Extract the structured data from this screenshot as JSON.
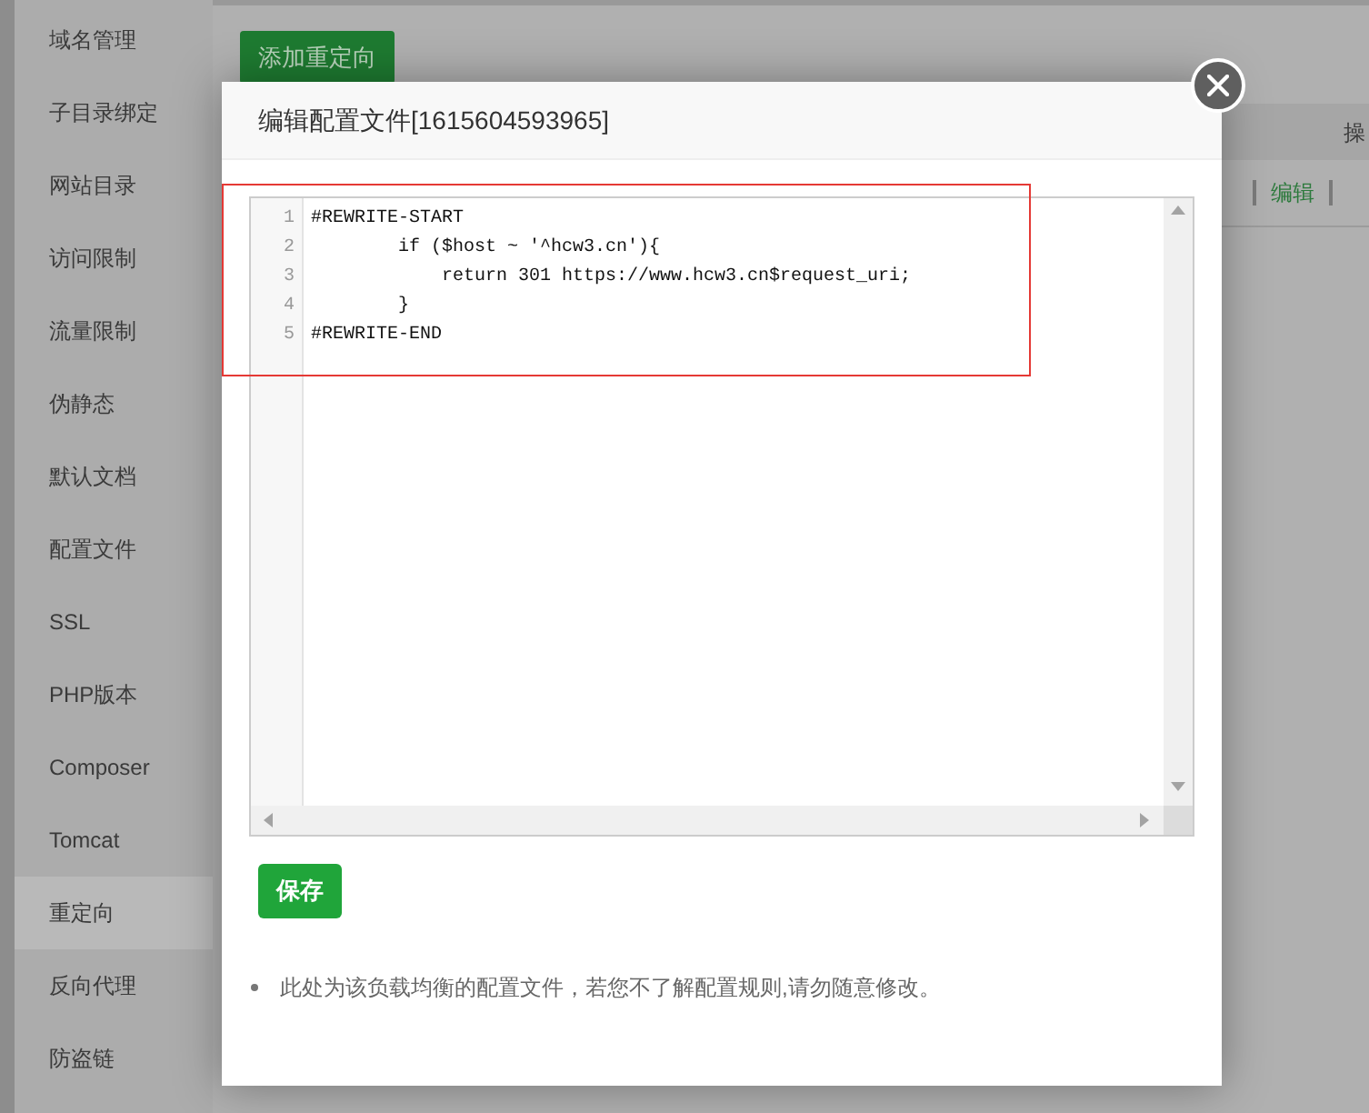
{
  "sidebar": {
    "items": [
      {
        "label": "域名管理",
        "selected": false
      },
      {
        "label": "子目录绑定",
        "selected": false
      },
      {
        "label": "网站目录",
        "selected": false
      },
      {
        "label": "访问限制",
        "selected": false
      },
      {
        "label": "流量限制",
        "selected": false
      },
      {
        "label": "伪静态",
        "selected": false
      },
      {
        "label": "默认文档",
        "selected": false
      },
      {
        "label": "配置文件",
        "selected": false
      },
      {
        "label": "SSL",
        "selected": false
      },
      {
        "label": "PHP版本",
        "selected": false
      },
      {
        "label": "Composer",
        "selected": false
      },
      {
        "label": "Tomcat",
        "selected": false
      },
      {
        "label": "重定向",
        "selected": true
      },
      {
        "label": "反向代理",
        "selected": false
      },
      {
        "label": "防盗链",
        "selected": false
      }
    ]
  },
  "toolbar": {
    "add_button": "添加重定向"
  },
  "table": {
    "columns": [
      {
        "label": "操"
      }
    ],
    "rows": [
      {
        "actions": [
          "编辑"
        ]
      }
    ]
  },
  "dialog": {
    "title": "编辑配置文件[1615604593965]",
    "editor": {
      "lines": [
        {
          "number": "1",
          "code": "#REWRITE-START"
        },
        {
          "number": "2",
          "code": "        if ($host ~ '^hcw3.cn'){"
        },
        {
          "number": "3",
          "code": "            return 301 https://www.hcw3.cn$request_uri;"
        },
        {
          "number": "4",
          "code": "        }"
        },
        {
          "number": "5",
          "code": "#REWRITE-END"
        }
      ]
    },
    "save_button": "保存",
    "notes": [
      "此处为该负载均衡的配置文件，若您不了解配置规则,请勿随意修改。"
    ]
  }
}
